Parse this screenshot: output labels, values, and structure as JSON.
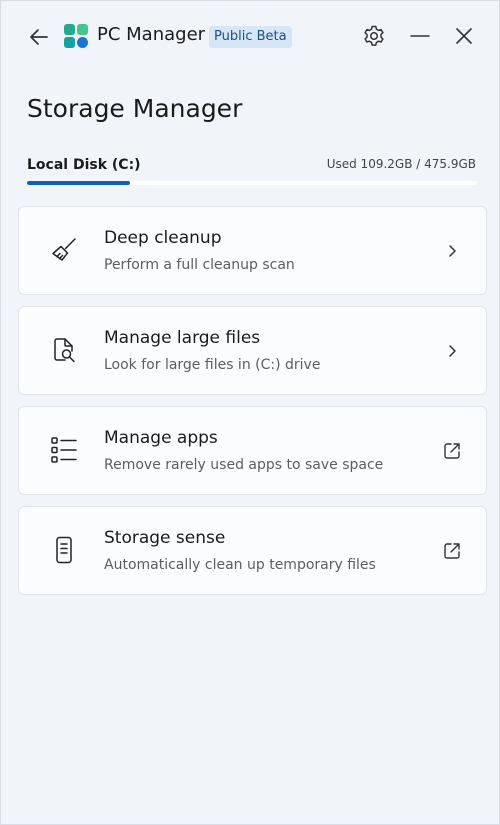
{
  "app": {
    "title": "PC Manager",
    "badge": "Public Beta"
  },
  "icons": {
    "back": "back-arrow-icon",
    "logo": "pc-manager-logo",
    "settings": "gear-icon",
    "minimize": "minimize-icon",
    "close": "close-icon"
  },
  "page": {
    "title": "Storage Manager"
  },
  "disk": {
    "label": "Local Disk (C:)",
    "usage_text": "Used 109.2GB / 475.9GB",
    "used_fraction": 0.229,
    "accent_color": "#0e5fb5"
  },
  "items": [
    {
      "title": "Deep cleanup",
      "subtitle": "Perform a full cleanup scan",
      "icon": "broom-icon",
      "action": "chevron-right-icon"
    },
    {
      "title": "Manage large files",
      "subtitle": "Look for large files in (C:) drive",
      "icon": "file-search-icon",
      "action": "chevron-right-icon"
    },
    {
      "title": "Manage apps",
      "subtitle": "Remove rarely used apps to save space",
      "icon": "list-icon",
      "action": "external-link-icon"
    },
    {
      "title": "Storage sense",
      "subtitle": "Automatically clean up temporary files",
      "icon": "phone-storage-icon",
      "action": "external-link-icon"
    }
  ]
}
